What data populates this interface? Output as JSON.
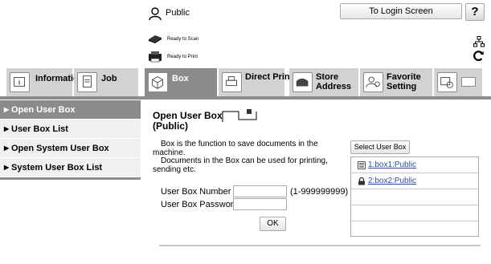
{
  "header": {
    "user": "Public",
    "login_button": "To Login Screen",
    "help_button": "?",
    "status": [
      {
        "label": "Ready to Scan",
        "icon": "scanner-icon"
      },
      {
        "label": "Ready to Print",
        "icon": "printer-icon"
      }
    ]
  },
  "tabs": [
    {
      "label": "Information",
      "icon": "information-icon",
      "active": false
    },
    {
      "label": "Job",
      "icon": "job-icon",
      "active": false
    },
    {
      "label": "Box",
      "icon": "box-icon",
      "active": true
    },
    {
      "label": "Direct Print",
      "icon": "direct-print-icon",
      "active": false
    },
    {
      "label": "Store",
      "label2": "Address",
      "icon": "store-address-icon",
      "active": false
    },
    {
      "label": "Favorite",
      "label2": "Setting",
      "icon": "favorite-setting-icon",
      "active": false
    },
    {
      "label": "",
      "icon": "customize-icon",
      "active": false
    }
  ],
  "sidebar": {
    "items": [
      {
        "label": "Open User Box",
        "active": true
      },
      {
        "label": "User Box List",
        "active": false
      },
      {
        "label": "Open System User Box",
        "active": false
      },
      {
        "label": "System User Box List",
        "active": false
      }
    ]
  },
  "main": {
    "title": "Open User Box",
    "subtitle": "(Public)",
    "description_1": "Box is the function to save documents in the",
    "description_1b": "machine.",
    "description_2": "Documents in the Box can be used for printing,",
    "description_2b": "sending etc.",
    "user_box_number_label": "User Box Number",
    "user_box_number_value": "",
    "range_hint": "(1-999999999)",
    "user_box_password_label": "User Box Password",
    "user_box_password_value": "",
    "ok_button": "OK",
    "select_button": "Select User Box",
    "boxes": [
      {
        "label": "1:box1:Public",
        "icon": "box-icon"
      },
      {
        "label": "2:box2:Public",
        "icon": "lock-icon"
      }
    ]
  },
  "colors": {
    "active_tab": "#8b8b8b",
    "inactive_tab": "#d2d2d2",
    "sidebar_bg": "#f0f0f0",
    "link": "#2a4fa0"
  }
}
